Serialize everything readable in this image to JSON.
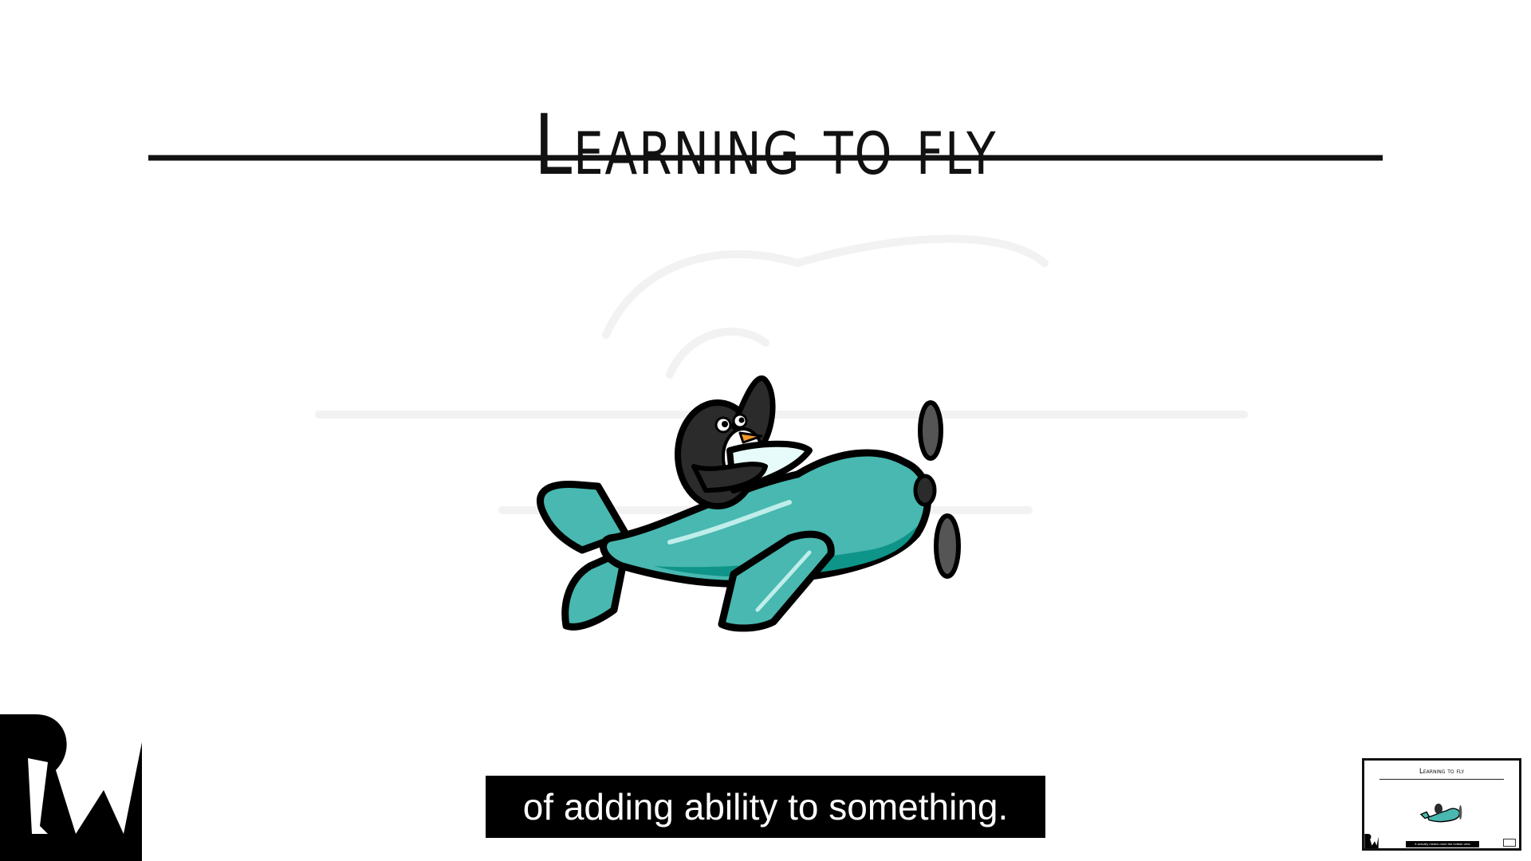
{
  "slide": {
    "title": "Learning to fly"
  },
  "subtitle": {
    "text": "of adding ability to something."
  },
  "thumbnail": {
    "title": "Learning to fly",
    "caption": "It actually means more the holistic view"
  },
  "colors": {
    "plane_teal": "#48b8b0",
    "plane_dark": "#0e9488",
    "penguin_black": "#2b2b2b",
    "beak_orange": "#f29a2e",
    "subtitle_bg": "#000000",
    "subtitle_fg": "#ffffff"
  },
  "icons": {
    "logo": "rw-logo-icon",
    "illustration": "penguin-airplane-icon"
  }
}
